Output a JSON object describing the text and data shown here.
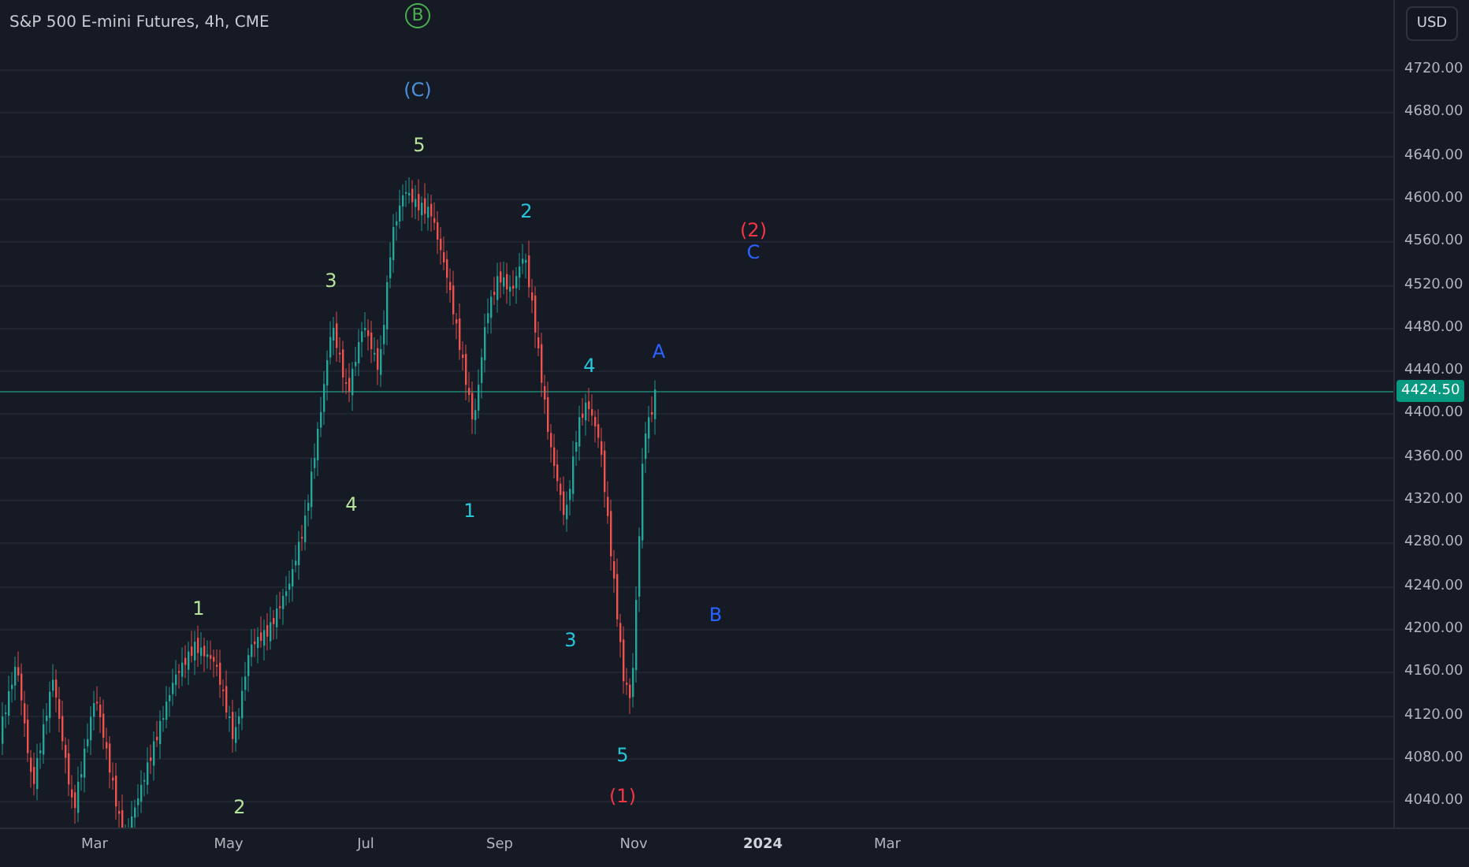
{
  "chart": {
    "title": "S&P 500 E-mini Futures, 4h, CME"
  },
  "wave_labels": [
    {
      "text": "B",
      "kind": "circled",
      "color": "#4caf50"
    },
    {
      "text": "(C)",
      "kind": "plain",
      "color": "#4a90d9"
    },
    {
      "text": "5",
      "kind": "plain",
      "color": "#b5e39b"
    },
    {
      "text": "3",
      "kind": "plain",
      "color": "#b5e39b"
    },
    {
      "text": "4",
      "kind": "plain",
      "color": "#b5e39b"
    },
    {
      "text": "1",
      "kind": "plain",
      "color": "#b5e39b"
    },
    {
      "text": "2",
      "kind": "plain",
      "color": "#b5e39b"
    },
    {
      "text": "2",
      "kind": "plain",
      "color": "#26c6da"
    },
    {
      "text": "1",
      "kind": "plain",
      "color": "#26c6da"
    },
    {
      "text": "4",
      "kind": "plain",
      "color": "#26c6da"
    },
    {
      "text": "3",
      "kind": "plain",
      "color": "#26c6da"
    },
    {
      "text": "5",
      "kind": "plain",
      "color": "#26c6da"
    },
    {
      "text": "A",
      "kind": "plain",
      "color": "#2962ff"
    },
    {
      "text": "B",
      "kind": "plain",
      "color": "#2962ff"
    },
    {
      "text": "(2)",
      "kind": "plain",
      "color": "#f23645"
    },
    {
      "text": "C",
      "kind": "plain",
      "color": "#2962ff"
    },
    {
      "text": "(1)",
      "kind": "plain",
      "color": "#f23645"
    }
  ],
  "price_axis": {
    "currency": "USD",
    "ticks": [
      "4720.00",
      "4680.00",
      "4640.00",
      "4600.00",
      "4560.00",
      "4520.00",
      "4480.00",
      "4440.00",
      "4400.00",
      "4360.00",
      "4320.00",
      "4280.00",
      "4240.00",
      "4200.00",
      "4160.00",
      "4120.00",
      "4080.00",
      "4040.00"
    ],
    "last_price": "4424.50"
  },
  "time_axis": [
    {
      "label": "Mar",
      "kind": "month"
    },
    {
      "label": "May",
      "kind": "month"
    },
    {
      "label": "Jul",
      "kind": "month"
    },
    {
      "label": "Sep",
      "kind": "month"
    },
    {
      "label": "Nov",
      "kind": "month"
    },
    {
      "label": "2024",
      "kind": "year"
    },
    {
      "label": "Mar",
      "kind": "month"
    }
  ]
}
